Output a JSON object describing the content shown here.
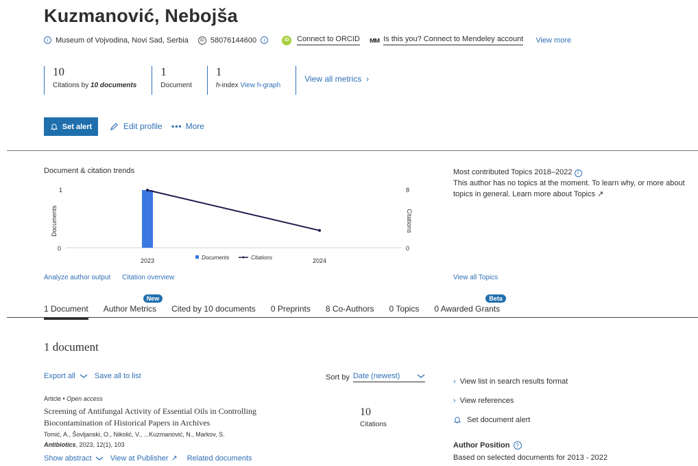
{
  "author": {
    "name": "Kuzmanović, Nebojša",
    "affiliation": "Museum of Vojvodina, Novi Sad, Serbia",
    "scopus_id": "58076144600",
    "connect_orcid": "Connect to ORCID",
    "mendeley": "Is this you? Connect to Mendeley account",
    "view_more": "View more"
  },
  "metrics": [
    {
      "value": "10",
      "label_prefix": "Citations by ",
      "label_emph": "10 documents"
    },
    {
      "value": "1",
      "label": "Document"
    },
    {
      "value": "1",
      "label_emph": "h",
      "label_rest": "-index ",
      "link": "View h-graph"
    }
  ],
  "view_all_metrics": "View all metrics",
  "actions": {
    "set_alert": "Set alert",
    "edit_profile": "Edit profile",
    "more": "More"
  },
  "trends": {
    "title": "Document & citation trends",
    "analyze": "Analyze author output",
    "citation_overview": "Citation overview"
  },
  "chart_data": {
    "type": "bar",
    "categories": [
      "2023",
      "2024"
    ],
    "series": [
      {
        "name": "Documents",
        "type": "bar",
        "values": [
          1,
          0
        ],
        "axis": "left",
        "color": "#3b78e0"
      },
      {
        "name": "Citations",
        "type": "line",
        "values": [
          8,
          2.4
        ],
        "axis": "right",
        "color": "#1b1b4d"
      }
    ],
    "ylabel": "Documents",
    "y2label": "Citations",
    "ylim": [
      0,
      1
    ],
    "y2lim": [
      0,
      8
    ],
    "yticks": [
      "1",
      "0"
    ],
    "y2ticks": [
      "8",
      "0"
    ],
    "legend_position": "bottom-center"
  },
  "topics": {
    "title": "Most contributed Topics 2018–2022",
    "text": "This author has no topics at the moment. To learn why, or more about topics in general. Learn more about Topics",
    "view_all": "View all Topics"
  },
  "tabs": [
    {
      "label": "1 Document",
      "active": true
    },
    {
      "label": "Author Metrics",
      "badge": "New"
    },
    {
      "label": "Cited by 10 documents"
    },
    {
      "label": "0 Preprints"
    },
    {
      "label": "8 Co-Authors"
    },
    {
      "label": "0 Topics"
    },
    {
      "label": "0 Awarded Grants",
      "badge": "Beta"
    }
  ],
  "documents": {
    "heading": "1 document",
    "export_all": "Export all",
    "save_all": "Save all to list",
    "sort_by_label": "Sort by",
    "sort_value": "Date (newest)",
    "items": [
      {
        "type": "Article",
        "access": "Open access",
        "title_line1": "Screening of Antifungal Activity of Essential Oils in Controlling",
        "title_line2": "Biocontamination of Historical Papers in Archives",
        "authors": "Tomić, A., Šovljanski, O., Nikolić, V., ...Kuzmanović, N., Markov, S.",
        "journal": "Antibiotics",
        "citation": ", 2023, 12(1), 103",
        "citations_count": "10",
        "citations_label": "Citations",
        "show_abstract": "Show abstract",
        "view_publisher": "View at Publisher",
        "related": "Related documents"
      }
    ]
  },
  "side_links": {
    "results_format": "View list in search results format",
    "references": "View references",
    "doc_alert": "Set document alert"
  },
  "author_position": {
    "title": "Author Position",
    "text": "Based on selected documents for 2013 - 2022"
  }
}
